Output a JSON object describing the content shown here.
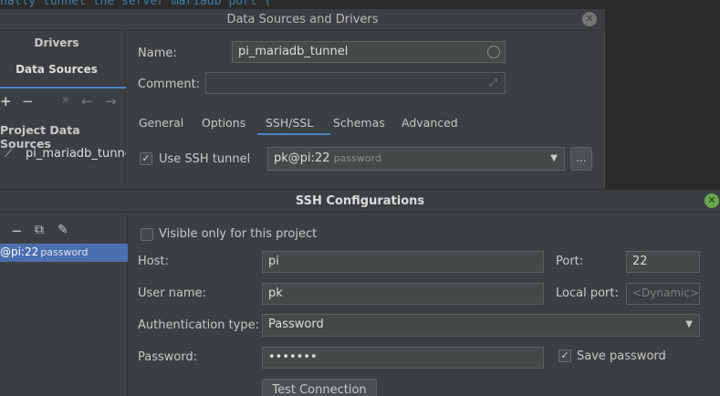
{
  "background": {
    "editor_text": "nally tunnel the server mariadb port ("
  },
  "data_sources_dialog": {
    "title": "Data Sources and Drivers",
    "sidebar": {
      "tabs": [
        "Drivers",
        "Data Sources"
      ],
      "toolbar": {
        "add": "+",
        "remove": "−",
        "more": "»",
        "back": "←",
        "forward": "→"
      },
      "section_title": "Project Data Sources",
      "items": [
        {
          "label": "pi_mariadb_tunnel",
          "icon": "connection-icon"
        }
      ]
    },
    "form": {
      "name_label": "Name:",
      "name_value": "pi_mariadb_tunnel",
      "comment_label": "Comment:",
      "comment_value": ""
    },
    "tabs": [
      "General",
      "Options",
      "SSH/SSL",
      "Schemas",
      "Advanced"
    ],
    "active_tab": "SSH/SSL",
    "ssh": {
      "use_tunnel_label": "Use SSH tunnel",
      "use_tunnel_checked": true,
      "config_value": "pk@pi:22",
      "config_sub": "password",
      "more_button": "..."
    }
  },
  "ssh_dialog": {
    "title": "SSH Configurations",
    "sidebar": {
      "toolbar": {
        "remove": "−",
        "copy": "⧉",
        "edit": "✎"
      },
      "items": [
        {
          "label": "@pi:22",
          "sub": "password",
          "selected": true
        }
      ]
    },
    "visible_only_label": "Visible only for this project",
    "visible_only_checked": false,
    "host_label": "Host:",
    "host_value": "pi",
    "port_label": "Port:",
    "port_value": "22",
    "username_label": "User name:",
    "username_value": "pk",
    "local_port_label": "Local port:",
    "local_port_placeholder": "<Dynamic>",
    "auth_type_label": "Authentication type:",
    "auth_type_value": "Password",
    "password_label": "Password:",
    "password_value": "•••••••",
    "save_password_label": "Save password",
    "save_password_checked": true,
    "test_connection_label": "Test Connection"
  },
  "colors": {
    "accent": "#4a88c7",
    "selection": "#4b6eaf",
    "dialog_bg": "#3c3f41",
    "field_bg": "#45494a"
  }
}
